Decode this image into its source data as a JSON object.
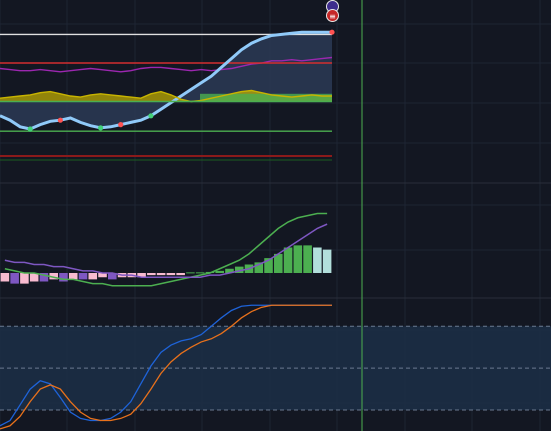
{
  "chart_data": [
    {
      "type": "area",
      "panel": "price-indicator",
      "x": [
        0,
        1,
        2,
        3,
        4,
        5,
        6,
        7,
        8,
        9,
        10,
        11,
        12,
        13,
        14,
        15,
        16,
        17,
        18,
        19,
        20,
        21,
        22,
        23,
        24,
        25,
        26,
        27,
        28,
        29,
        30,
        31,
        32,
        33
      ],
      "series": [
        {
          "name": "",
          "color": "#e0e0e0",
          "values": [
            96,
            96,
            96,
            96,
            96,
            96,
            96,
            96,
            96,
            96,
            96,
            96,
            96,
            96,
            96,
            96,
            96,
            96,
            96,
            96,
            96,
            96,
            96,
            96,
            96,
            96,
            96,
            96,
            96,
            96,
            96,
            96,
            96,
            96
          ]
        },
        {
          "name": "",
          "color": "#9c27b0",
          "values": [
            65,
            64,
            63,
            63,
            64,
            63,
            62,
            63,
            64,
            65,
            64,
            63,
            62,
            63,
            65,
            66,
            66,
            65,
            64,
            63,
            64,
            63,
            64,
            65,
            67,
            69,
            70,
            72,
            72,
            73,
            72,
            73,
            74,
            75
          ]
        },
        {
          "name": "",
          "color": "#d32f2f",
          "values": [
            70,
            70,
            70,
            70,
            70,
            70,
            70,
            70,
            70,
            70,
            70,
            70,
            70,
            70,
            70,
            70,
            70,
            70,
            70,
            70,
            70,
            70,
            70,
            70,
            70,
            70,
            70,
            70,
            70,
            70,
            70,
            70,
            70,
            70
          ]
        },
        {
          "name": "",
          "color": "#90caf9",
          "values": [
            22,
            18,
            12,
            10,
            14,
            17,
            18,
            20,
            16,
            13,
            11,
            12,
            14,
            16,
            18,
            22,
            28,
            34,
            40,
            46,
            52,
            58,
            66,
            74,
            82,
            88,
            92,
            95,
            96,
            97,
            98,
            98,
            98,
            98
          ]
        },
        {
          "name": "",
          "color": "#c8b400",
          "values": [
            38,
            39,
            40,
            41,
            43,
            44,
            42,
            40,
            39,
            41,
            42,
            41,
            40,
            39,
            38,
            42,
            44,
            41,
            37,
            35,
            36,
            38,
            40,
            42,
            44,
            45,
            43,
            41,
            40,
            39,
            40,
            41,
            40,
            40
          ]
        },
        {
          "name": "",
          "color": "#4caf50",
          "values": [
            35,
            35,
            35,
            35,
            35,
            35,
            35,
            35,
            35,
            35,
            35,
            35,
            35,
            35,
            35,
            35,
            35,
            35,
            35,
            35,
            35,
            35,
            35,
            35,
            35,
            35,
            35,
            35,
            35,
            35,
            35,
            35,
            35,
            35
          ]
        },
        {
          "name": "",
          "color": "#4caf50",
          "values": [
            8,
            8,
            8,
            8,
            8,
            8,
            8,
            8,
            8,
            8,
            8,
            8,
            8,
            8,
            8,
            8,
            8,
            8,
            8,
            8,
            8,
            8,
            8,
            8,
            8,
            8,
            8,
            8,
            8,
            8,
            8,
            8,
            8,
            8
          ]
        }
      ],
      "markers_green": [
        3,
        10,
        15
      ],
      "markers_red": [
        6,
        12
      ]
    },
    {
      "type": "bar",
      "panel": "histogram",
      "x": [
        0,
        1,
        2,
        3,
        4,
        5,
        6,
        7,
        8,
        9,
        10,
        11,
        12,
        13,
        14,
        15,
        16,
        17,
        18,
        19,
        20,
        21,
        22,
        23,
        24,
        25,
        26,
        27,
        28,
        29,
        30,
        31,
        32,
        33
      ],
      "values": [
        -4,
        -5,
        -5,
        -4,
        -4,
        -3,
        -4,
        -3,
        -3,
        -3,
        -2,
        -3,
        -2,
        -2,
        -2,
        -1,
        -1,
        -1,
        -1,
        0.3,
        0.3,
        0.5,
        1,
        2,
        3,
        4,
        5,
        7,
        9,
        12,
        13,
        13,
        12,
        11
      ],
      "colors": [
        "#f8bbd0",
        "#7e57c2",
        "#f8bbd0",
        "#f8bbd0",
        "#7e57c2",
        "#f8bbd0",
        "#7e57c2",
        "#f8bbd0",
        "#7e57c2",
        "#f8bbd0",
        "#f8bbd0",
        "#7e57c2",
        "#f8bbd0",
        "#f8bbd0",
        "#f8bbd0",
        "#f8bbd0",
        "#f8bbd0",
        "#f8bbd0",
        "#f8bbd0",
        "#4caf50",
        "#4caf50",
        "#4caf50",
        "#4caf50",
        "#4caf50",
        "#4caf50",
        "#4caf50",
        "#4caf50",
        "#4caf50",
        "#4caf50",
        "#4caf50",
        "#4caf50",
        "#4caf50",
        "#b2dfdb",
        "#b2dfdb"
      ],
      "series": [
        {
          "name": "",
          "color": "#4caf50",
          "values": [
            2,
            1,
            0,
            0,
            -1,
            -2,
            -3,
            -3,
            -4,
            -5,
            -5,
            -6,
            -6,
            -6,
            -6,
            -6,
            -5,
            -4,
            -3,
            -2,
            -1,
            0,
            2,
            4,
            6,
            9,
            13,
            17,
            21,
            24,
            26,
            27,
            28,
            28
          ]
        },
        {
          "name": "",
          "color": "#7e57c2",
          "values": [
            6,
            5,
            5,
            4,
            4,
            3,
            3,
            2,
            1,
            1,
            0,
            0,
            -1,
            -1,
            -2,
            -2,
            -2,
            -2,
            -2,
            -2,
            -2,
            -1,
            -1,
            0,
            1,
            2,
            4,
            6,
            9,
            12,
            15,
            18,
            21,
            23
          ]
        }
      ],
      "ylim": [
        -8,
        32
      ]
    },
    {
      "type": "line",
      "panel": "oscillator",
      "x": [
        0,
        1,
        2,
        3,
        4,
        5,
        6,
        7,
        8,
        9,
        10,
        11,
        12,
        13,
        14,
        15,
        16,
        17,
        18,
        19,
        20,
        21,
        22,
        23,
        24,
        25,
        26,
        27,
        28,
        29,
        30,
        31,
        32,
        33
      ],
      "series": [
        {
          "name": "",
          "color": "#1e63d8",
          "values": [
            5,
            10,
            25,
            40,
            48,
            45,
            32,
            18,
            12,
            10,
            10,
            12,
            18,
            28,
            45,
            62,
            75,
            82,
            86,
            88,
            92,
            100,
            108,
            115,
            119,
            120,
            120,
            120,
            120,
            120,
            120,
            120,
            120,
            120
          ]
        },
        {
          "name": "",
          "color": "#e8711b",
          "values": [
            2,
            5,
            14,
            28,
            40,
            44,
            40,
            28,
            18,
            12,
            10,
            10,
            12,
            16,
            26,
            40,
            55,
            66,
            74,
            80,
            85,
            88,
            93,
            100,
            108,
            114,
            118,
            120,
            120,
            120,
            120,
            120,
            120,
            120
          ]
        }
      ],
      "bands": [
        100,
        60,
        20
      ],
      "ylim": [
        0,
        125
      ]
    }
  ]
}
